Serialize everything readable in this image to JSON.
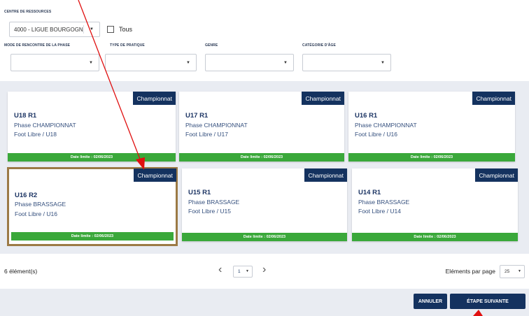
{
  "filters": {
    "resource_center_label": "CENTRE DE RESSOURCES",
    "resource_center_value": "4000 - LIGUE BOURGOGN",
    "all_label": "Tous",
    "meeting_mode_label": "MODE DE RENCONTRE DE LA PHASE",
    "practice_type_label": "TYPE DE PRATIQUE",
    "gender_label": "GENRE",
    "age_category_label": "CATÉGORIE D'ÂGE",
    "meeting_mode_value": "",
    "practice_type_value": "",
    "gender_value": "",
    "age_category_value": ""
  },
  "cards": [
    {
      "badge": "Championnat",
      "title": "U18 R1",
      "phase": "Phase CHAMPIONNAT",
      "sub": "Foot Libre / U18",
      "deadline": "Date limite : 02/06/2023"
    },
    {
      "badge": "Championnat",
      "title": "U17 R1",
      "phase": "Phase CHAMPIONNAT",
      "sub": "Foot Libre / U17",
      "deadline": "Date limite : 02/06/2023"
    },
    {
      "badge": "Championnat",
      "title": "U16 R1",
      "phase": "Phase CHAMPIONNAT",
      "sub": "Foot Libre / U16",
      "deadline": "Date limite : 02/06/2023"
    },
    {
      "badge": "Championnat",
      "title": "U16 R2",
      "phase": "Phase BRASSAGE",
      "sub": "Foot Libre / U16",
      "deadline": "Date limite : 02/06/2023"
    },
    {
      "badge": "Championnat",
      "title": "U15 R1",
      "phase": "Phase BRASSAGE",
      "sub": "Foot Libre / U15",
      "deadline": "Date limite : 02/06/2023"
    },
    {
      "badge": "Championnat",
      "title": "U14 R1",
      "phase": "Phase BRASSAGE",
      "sub": "Foot Libre / U14",
      "deadline": "Date limite : 02/06/2023"
    }
  ],
  "pagination": {
    "count": "6 élément(s)",
    "page": "1",
    "per_page_label": "Eléments par page",
    "per_page": "25",
    "prev_icon": "chevron-left-icon",
    "next_icon": "chevron-right-icon"
  },
  "actions": {
    "cancel_label": "ANNULER",
    "next_label": "ÉTAPE SUIVANTE"
  },
  "colors": {
    "navy": "#14325f",
    "green": "#3aa83a",
    "selection_border": "#9c7a45",
    "annotation_red": "#e01010"
  }
}
